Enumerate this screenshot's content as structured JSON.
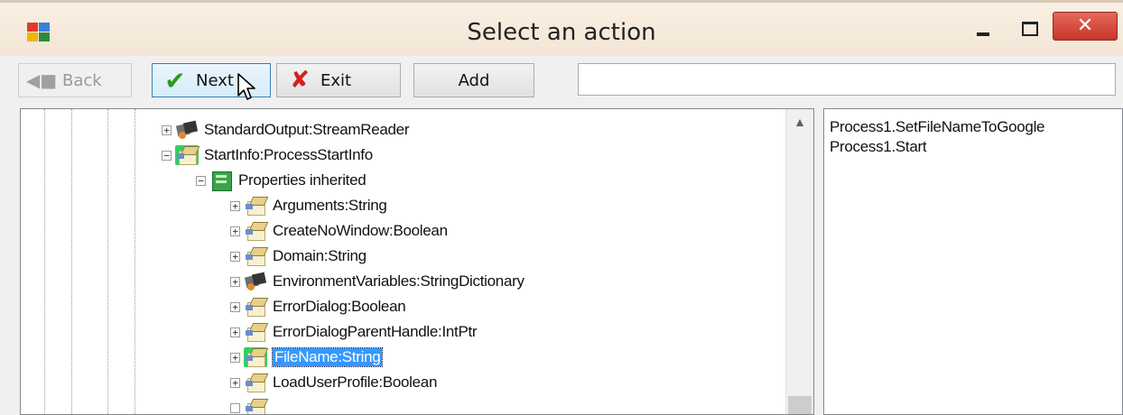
{
  "window": {
    "title": "Select an action",
    "close_symbol": "✕"
  },
  "toolbar": {
    "back_label": "Back",
    "next_label": "Next",
    "exit_label": "Exit",
    "add_label": "Add",
    "search_value": ""
  },
  "tree": {
    "nodes": [
      {
        "label": "StandardOutput:StreamReader",
        "expander": "+",
        "icon": "object-icon"
      },
      {
        "label": "StartInfo:ProcessStartInfo",
        "expander": "−",
        "icon": "property-icon"
      },
      {
        "label": "Properties inherited",
        "expander": "−",
        "icon": "group-icon"
      },
      {
        "label": "Arguments:String",
        "expander": "+",
        "icon": "property-icon"
      },
      {
        "label": "CreateNoWindow:Boolean",
        "expander": "+",
        "icon": "property-icon"
      },
      {
        "label": "Domain:String",
        "expander": "+",
        "icon": "property-icon"
      },
      {
        "label": "EnvironmentVariables:StringDictionary",
        "expander": "+",
        "icon": "object-icon"
      },
      {
        "label": "ErrorDialog:Boolean",
        "expander": "+",
        "icon": "property-icon"
      },
      {
        "label": "ErrorDialogParentHandle:IntPtr",
        "expander": "+",
        "icon": "property-icon"
      },
      {
        "label": "FileName:String",
        "expander": "+",
        "icon": "property-icon",
        "selected": true
      },
      {
        "label": "LoadUserProfile:Boolean",
        "expander": "+",
        "icon": "property-icon"
      }
    ]
  },
  "actions": {
    "items": [
      "Process1.SetFileNameToGoogle",
      "Process1.Start"
    ]
  },
  "colors": {
    "selection": "#3399ff",
    "close_button": "#c7352a",
    "next_check": "#2c9b1c",
    "exit_cross": "#d42020"
  }
}
